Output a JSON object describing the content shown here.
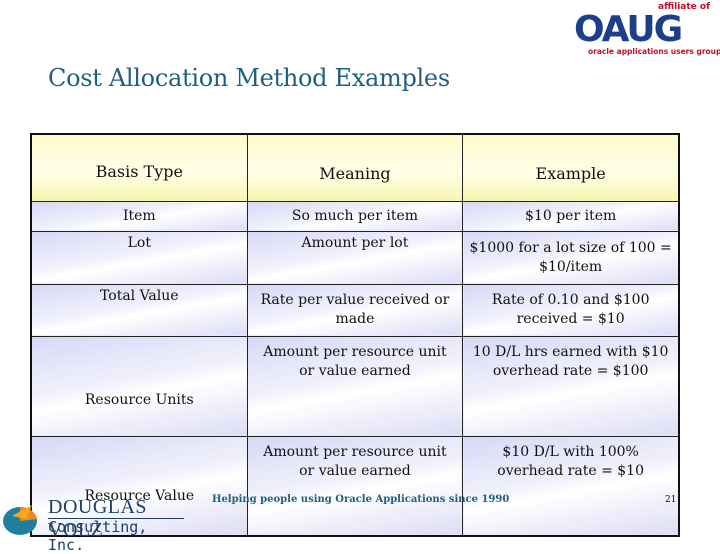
{
  "title": "Cost Allocation Method Examples",
  "header_logo": {
    "affiliate": "affiliate of",
    "name": "OAUG",
    "tagline": "oracle applications users group"
  },
  "table": {
    "headers": [
      "Basis Type",
      "Meaning",
      "Example"
    ],
    "rows": [
      {
        "basis": "Item",
        "meaning": "So much per item",
        "example": "$10 per item"
      },
      {
        "basis": "Lot",
        "meaning": "Amount per lot",
        "example": "$1000 for a lot size of 100 = $10/item"
      },
      {
        "basis": "Total Value",
        "meaning": "Rate per value received or made",
        "example": "Rate of 0.10 and $100 received = $10"
      },
      {
        "basis": "Resource Units",
        "meaning": "Amount per resource unit or value earned",
        "example": "10 D/L hrs earned with $10 overhead rate = $100"
      },
      {
        "basis": "Resource Value",
        "meaning": "Amount per resource unit or value earned",
        "example": "$10 D/L with 100% overhead rate = $10"
      }
    ]
  },
  "footer": {
    "company_line1": "DOUGLAS VOLZ",
    "company_line2": "Consulting, Inc.",
    "tagline": "Helping people using Oracle Applications since 1990",
    "page_number": "21"
  }
}
